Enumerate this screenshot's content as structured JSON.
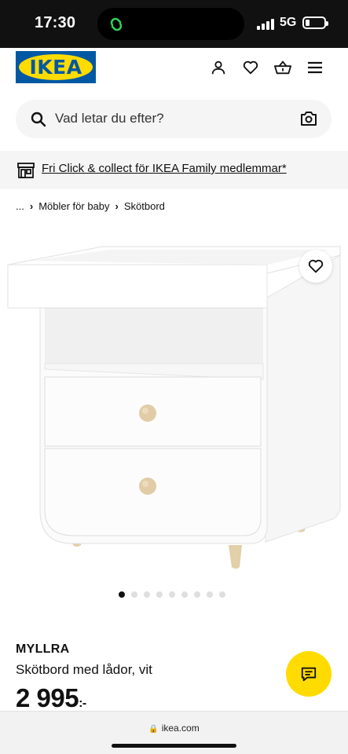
{
  "status_bar": {
    "time": "17:30",
    "network": "5G"
  },
  "header": {
    "logo_text": "IKEA",
    "icons": [
      "profile-icon",
      "heart-icon",
      "basket-icon",
      "menu-icon"
    ]
  },
  "search": {
    "placeholder": "Vad letar du efter?"
  },
  "promo": {
    "text": "Fri Click & collect för IKEA Family medlemmar*"
  },
  "breadcrumb": {
    "ellipsis": "...",
    "items": [
      "Möbler för baby",
      "Skötbord"
    ]
  },
  "carousel": {
    "total": 9,
    "active": 1
  },
  "product": {
    "name": "MYLLRA",
    "description": "Skötbord med lådor, vit",
    "price": "2 995",
    "price_suffix": ":-"
  },
  "browser": {
    "url": "ikea.com"
  },
  "colors": {
    "ikea_blue": "#0058a3",
    "ikea_yellow": "#ffdb00"
  }
}
